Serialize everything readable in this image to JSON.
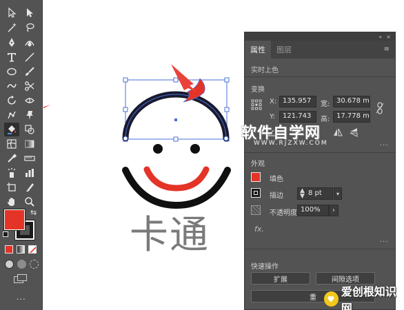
{
  "panel": {
    "tabs": [
      "属性",
      "图层"
    ],
    "menu_glyph": "≡",
    "collapse_glyph": "«",
    "close_glyph": "×",
    "selection_label": "实时上色",
    "transform": {
      "title": "变换",
      "x_label": "X:",
      "x_value": "135.957",
      "y_label": "Y:",
      "y_value": "121.743",
      "w_label": "宽:",
      "w_value": "30.678 m",
      "h_label": "高:",
      "h_value": "17.778 m",
      "more": "..."
    },
    "appearance": {
      "title": "外观",
      "fill_label": "填色",
      "stroke_label": "描边",
      "stroke_value": "8 pt",
      "opacity_label": "不透明度",
      "opacity_value": "100%",
      "fx_label": "fx.",
      "more": "..."
    },
    "quick_actions": {
      "title": "快速操作",
      "expand_label": "扩展",
      "gap_options_label": "间隙选项",
      "partial_label": "重"
    }
  },
  "artwork": {
    "caption": "卡通"
  },
  "watermark": {
    "site_title": "软件自学网",
    "site_url": "WWW.RJZXW.COM",
    "bottom_text": "爱创根知识网"
  },
  "colors": {
    "fill_red": "#e43327",
    "arrow_red": "#e8423a",
    "face_black": "#101010",
    "head_dark": "#1a1a2e",
    "selection_blue": "#4a6fd8",
    "caption_gray": "#7a7a7a"
  },
  "icons": {
    "toolbar": [
      "selection-tool",
      "direct-selection-tool",
      "magic-wand-tool",
      "lasso-tool",
      "pen-tool",
      "curvature-tool",
      "type-tool",
      "line-tool",
      "ellipse-tool",
      "paintbrush-tool",
      "shaper-tool",
      "scissors-tool",
      "rotate-tool",
      "width-tool",
      "puppet-warp-tool",
      "pin-tool",
      "live-paint-bucket-tool",
      "shape-builder-tool",
      "mesh-tool",
      "gradient-tool",
      "eyedropper-tool",
      "measure-tool",
      "symbol-sprayer-tool",
      "column-graph-tool",
      "artboard-tool",
      "slice-tool",
      "hand-tool",
      "zoom-tool"
    ]
  }
}
